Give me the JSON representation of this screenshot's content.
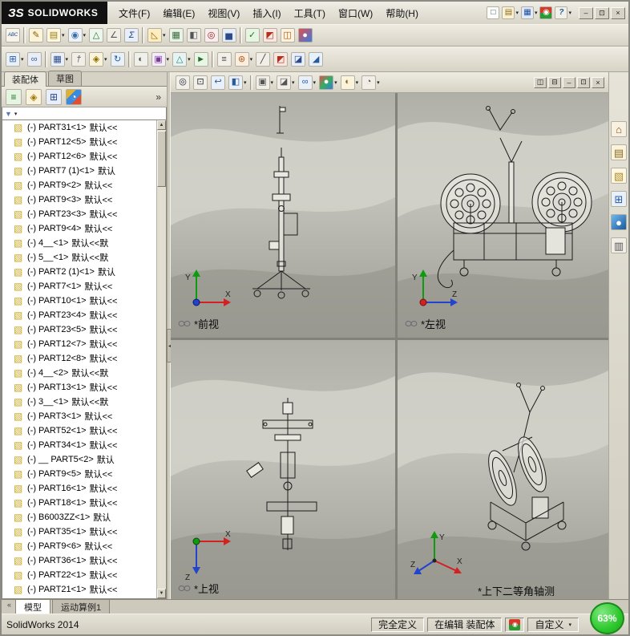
{
  "ui": {
    "dropdown_glyph": "▾",
    "scroll_up_glyph": "▲",
    "scroll_down_glyph": "▼",
    "collapse_glyph": "◂",
    "tab_scroll_glyph": "«"
  },
  "axes": {
    "x": "X",
    "y": "Y",
    "z": "Z"
  },
  "titlebar": {
    "logo": {
      "prefix": "ЗS",
      "text": "SOLIDWORKS"
    },
    "menus": [
      {
        "label": "文件(F)"
      },
      {
        "label": "编辑(E)"
      },
      {
        "label": "视图(V)"
      },
      {
        "label": "插入(I)"
      },
      {
        "label": "工具(T)"
      },
      {
        "label": "窗口(W)"
      },
      {
        "label": "帮助(H)"
      }
    ],
    "quick_icons": [
      {
        "name": "new-document-icon",
        "glyph": "□",
        "css": "color:#33506e;background:#fdfdfa"
      },
      {
        "name": "open-folder-icon",
        "glyph": "▤",
        "css": "color:#8a6a10;background:#fbf2d6",
        "dd": true
      },
      {
        "name": "save-icon",
        "glyph": "▦",
        "css": "color:#1c4f9c;background:#dfe9fa",
        "dd": true
      },
      {
        "name": "rebuild-traffic-icon",
        "glyph": "◉",
        "css": "color:#fff;background:linear-gradient(180deg,#d43a2a 50%,#2a9a32 50%)"
      },
      {
        "name": "help-icon",
        "glyph": "?",
        "css": "color:#1a5a9a;background:#f2f0e8;font-weight:bold",
        "dd": true
      }
    ],
    "window_buttons": [
      {
        "name": "minimize-button",
        "glyph": "–"
      },
      {
        "name": "restore-button",
        "glyph": "⊡"
      },
      {
        "name": "close-button",
        "glyph": "×"
      }
    ]
  },
  "toolbar1": {
    "icons": [
      {
        "name": "spellcheck-icon",
        "glyph": "ABC",
        "css": "color:#14427e;background:#f6f4ec;font-size:6px"
      },
      {
        "name": "toolbar-separator",
        "glyph": "",
        "inter": "false",
        "css": "width:3px;height:20px;background:transparent;border:none;border-left:1px solid #a09c90;border-right:1px solid #faf8f0;border-radius:0"
      },
      {
        "name": "format-painter-icon",
        "glyph": "✎",
        "css": "color:#8a5a00;background:#fcf4d8"
      },
      {
        "name": "note-icon",
        "glyph": "▤",
        "css": "color:#9a7a10;background:#fdf8e0",
        "dd": true
      },
      {
        "name": "balloon-icon",
        "glyph": "◉",
        "css": "color:#3a6ea5;background:#eef2fa",
        "dd": true
      },
      {
        "name": "surface-finish-icon",
        "glyph": "△",
        "css": "color:#2a6a2a;background:#ecf6ec"
      },
      {
        "name": "weld-symbol-icon",
        "glyph": "∠",
        "css": "color:#555;background:#f0eee4"
      },
      {
        "name": "equations-icon",
        "glyph": "Σ",
        "css": "color:#16407c;background:#e8eefa"
      },
      {
        "name": "toolbar-separator",
        "glyph": "",
        "inter": "false",
        "css": "width:3px;height:20px;background:transparent;border:none;border-left:1px solid #a09c90;border-right:1px solid #faf8f0;border-radius:0"
      },
      {
        "name": "measure-icon",
        "glyph": "◺",
        "css": "color:#a06a00;background:#fdeec2",
        "dd": true
      },
      {
        "name": "mass-properties-icon",
        "glyph": "▦",
        "css": "color:#3a6a3a;background:#e8f2e6"
      },
      {
        "name": "section-properties-icon",
        "glyph": "◧",
        "css": "color:#555;background:#eceae2"
      },
      {
        "name": "sensor-icon",
        "glyph": "◎",
        "css": "color:#8a2020;background:#f8ecec"
      },
      {
        "name": "performance-evaluation-icon",
        "glyph": "▅",
        "css": "color:#2a4a8a;background:#e6ecf8"
      },
      {
        "name": "toolbar-separator",
        "glyph": "",
        "inter": "false",
        "css": "width:3px;height:20px;background:transparent;border:none;border-left:1px solid #a09c90;border-right:1px solid #faf8f0;border-radius:0"
      },
      {
        "name": "check-entity-icon",
        "glyph": "✓",
        "css": "color:#1a7a1a;background:#e6f6e2"
      },
      {
        "name": "interference-detection-icon",
        "glyph": "◩",
        "css": "color:#b03020;background:#f8e8e0"
      },
      {
        "name": "hole-alignment-icon",
        "glyph": "◫",
        "css": "color:#b05a00;background:#fdf2e0"
      },
      {
        "name": "appearance-ball-icon",
        "glyph": "●",
        "css": "color:#fff;background:linear-gradient(135deg,#e05050,#3a7ae0)"
      }
    ]
  },
  "toolbar2": {
    "icons": [
      {
        "name": "insert-component-icon",
        "glyph": "⊞",
        "css": "color:#2a5a9a;background:#e8f0fa",
        "dd": true
      },
      {
        "name": "mate-icon",
        "glyph": "∞",
        "css": "color:#3a5a8a;background:#e8eef8"
      },
      {
        "name": "toolbar-separator",
        "glyph": "",
        "inter": "false",
        "css": "width:3px;height:20px;background:transparent;border:none;border-left:1px solid #a09c90;border-right:1px solid #faf8f0;border-radius:0"
      },
      {
        "name": "linear-component-pattern-icon",
        "glyph": "▦",
        "css": "color:#2a4a8a;background:#eaf0fa",
        "dd": true
      },
      {
        "name": "smart-fasteners-icon",
        "glyph": "†",
        "css": "color:#555;background:#f0eee6"
      },
      {
        "name": "move-component-icon",
        "glyph": "◈",
        "css": "color:#8a6a00;background:#fbf4d8",
        "dd": true
      },
      {
        "name": "rotate-component-icon",
        "glyph": "↻",
        "css": "color:#2a5a9a;background:#e8f0fa"
      },
      {
        "name": "toolbar-separator",
        "glyph": "",
        "inter": "false",
        "css": "width:3px;height:20px;background:transparent;border:none;border-left:1px solid #a09c90;border-right:1px solid #faf8f0;border-radius:0"
      },
      {
        "name": "show-hidden-components-icon",
        "glyph": "◐",
        "css": "color:#555;background:#f0f0ea"
      },
      {
        "name": "assembly-features-icon",
        "glyph": "▣",
        "css": "color:#7a3a9a;background:#f4ecf8",
        "dd": true
      },
      {
        "name": "reference-geometry-icon",
        "glyph": "△",
        "css": "color:#2a7a7a;background:#e6f4f4",
        "dd": true
      },
      {
        "name": "new-motion-study-icon",
        "glyph": "►",
        "css": "color:#2a6a2a;background:#e8f6e6"
      },
      {
        "name": "toolbar-separator",
        "glyph": "",
        "inter": "false",
        "css": "width:3px;height:20px;background:transparent;border:none;border-left:1px solid #a09c90;border-right:1px solid #faf8f0;border-radius:0"
      },
      {
        "name": "bill-of-materials-icon",
        "glyph": "≡",
        "css": "color:#444;background:#f2f0e8"
      },
      {
        "name": "exploded-view-icon",
        "glyph": "⊛",
        "css": "color:#b05a20;background:#fbeede",
        "dd": true
      },
      {
        "name": "explode-line-sketch-icon",
        "glyph": "╱",
        "css": "color:#444;background:#f0eee6"
      },
      {
        "name": "interference-volume-icon",
        "glyph": "◩",
        "css": "color:#b03020;background:#f8e6e0"
      },
      {
        "name": "isolate-icon",
        "glyph": "◪",
        "css": "color:#2a4a8a;background:#eaeefa"
      },
      {
        "name": "instant3d-icon",
        "glyph": "◢",
        "css": "color:#2a5a9a;background:#e8f0fa"
      }
    ]
  },
  "viewport": {
    "toolbar_icons": [
      {
        "name": "zoom-fit-icon",
        "glyph": "◎",
        "css": "color:#223;background:#f0f0e8"
      },
      {
        "name": "zoom-area-icon",
        "glyph": "⊡",
        "css": "color:#223;background:#f0f0e8"
      },
      {
        "name": "previous-view-icon",
        "glyph": "↩",
        "css": "color:#2a5a9a;background:#eaf0fa"
      },
      {
        "name": "section-view-icon",
        "glyph": "◧",
        "css": "color:#2a5a9a;background:#eaf0fa",
        "dd": true
      },
      {
        "name": "toolbar-separator",
        "glyph": "",
        "inter": "false",
        "css": "width:3px;height:18px;background:transparent;border:none;border-left:1px solid #a09c90;border-right:1px solid #faf8f0;border-radius:0"
      },
      {
        "name": "view-orientation-icon",
        "glyph": "▣",
        "css": "color:#555;background:#f0eee6",
        "dd": true
      },
      {
        "name": "display-style-icon",
        "glyph": "◪",
        "css": "color:#555;background:#f0eee6",
        "dd": true
      },
      {
        "name": "hide-show-items-icon",
        "glyph": "∞",
        "css": "color:#2a5a9a;background:#eaf0fa",
        "dd": true
      },
      {
        "name": "edit-appearance-icon",
        "glyph": "●",
        "css": "color:#fff;background:linear-gradient(135deg,#e05050,#30b060,#3a7ae0)",
        "dd": true
      },
      {
        "name": "apply-scene-icon",
        "glyph": "◐",
        "css": "color:#8a6a20;background:#fbf4dc",
        "dd": true
      },
      {
        "name": "view-settings-icon",
        "glyph": "◔",
        "css": "color:#555;background:#f0eee6",
        "dd": true
      }
    ],
    "window_buttons": [
      {
        "name": "pane-left-button",
        "glyph": "◫"
      },
      {
        "name": "pane-right-button",
        "glyph": "⊟"
      },
      {
        "name": "child-minimize-button",
        "glyph": "–"
      },
      {
        "name": "child-restore-button",
        "glyph": "⊡"
      },
      {
        "name": "child-close-button",
        "glyph": "×"
      }
    ],
    "views": [
      {
        "label": "*前视"
      },
      {
        "label": "*左视"
      },
      {
        "label": "*上视"
      },
      {
        "label": "*上下二等角轴测"
      }
    ]
  },
  "left_panel": {
    "tabs": [
      {
        "label": "装配体"
      },
      {
        "label": "草图"
      }
    ],
    "expand_label": "»",
    "part_icon_glyph": "▧",
    "manager_icons": [
      {
        "name": "featuremanager-tree-icon",
        "glyph": "≡",
        "css": "color:#1f6f1f;background:#e6f4e2"
      },
      {
        "name": "propertymanager-icon",
        "glyph": "◈",
        "css": "color:#a07a10;background:#fcf4da"
      },
      {
        "name": "configurationmanager-icon",
        "glyph": "⊞",
        "css": "color:#2a4a8a;background:#e8eefa"
      },
      {
        "name": "displaymanager-icon",
        "glyph": "◔",
        "css": "color:#fff;background:linear-gradient(135deg,#e0b030 33%,#3a8ae0 33% 66%,#e05030 66%)"
      }
    ],
    "tree_items": [
      {
        "name": "(-) PART31<1>",
        "config": "默认<<"
      },
      {
        "name": "(-) PART12<5>",
        "config": "默认<<"
      },
      {
        "name": "(-) PART12<6>",
        "config": "默认<<"
      },
      {
        "name": "(-) PART7 (1)<1>",
        "config": "默认"
      },
      {
        "name": "(-) PART9<2>",
        "config": "默认<<"
      },
      {
        "name": "(-) PART9<3>",
        "config": "默认<<"
      },
      {
        "name": "(-) PART23<3>",
        "config": "默认<<"
      },
      {
        "name": "(-) PART9<4>",
        "config": "默认<<"
      },
      {
        "name": "(-) 4__<1>",
        "config": "默认<<默"
      },
      {
        "name": "(-) 5__<1>",
        "config": "默认<<默"
      },
      {
        "name": "(-) PART2 (1)<1>",
        "config": "默认"
      },
      {
        "name": "(-) PART7<1>",
        "config": "默认<<"
      },
      {
        "name": "(-) PART10<1>",
        "config": "默认<<"
      },
      {
        "name": "(-) PART23<4>",
        "config": "默认<<"
      },
      {
        "name": "(-) PART23<5>",
        "config": "默认<<"
      },
      {
        "name": "(-) PART12<7>",
        "config": "默认<<"
      },
      {
        "name": "(-) PART12<8>",
        "config": "默认<<"
      },
      {
        "name": "(-) 4__<2>",
        "config": "默认<<默"
      },
      {
        "name": "(-) PART13<1>",
        "config": "默认<<"
      },
      {
        "name": "(-) 3__<1>",
        "config": "默认<<默"
      },
      {
        "name": "(-) PART3<1>",
        "config": "默认<<"
      },
      {
        "name": "(-) PART52<1>",
        "config": "默认<<"
      },
      {
        "name": "(-) PART34<1>",
        "config": "默认<<"
      },
      {
        "name": "(-) __ PART5<2>",
        "config": "默认"
      },
      {
        "name": "(-) PART9<5>",
        "config": "默认<<"
      },
      {
        "name": "(-) PART16<1>",
        "config": "默认<<"
      },
      {
        "name": "(-) PART18<1>",
        "config": "默认<<"
      },
      {
        "name": "(-) B6003ZZ<1>",
        "config": "默认"
      },
      {
        "name": "(-) PART35<1>",
        "config": "默认<<"
      },
      {
        "name": "(-) PART9<6>",
        "config": "默认<<"
      },
      {
        "name": "(-) PART36<1>",
        "config": "默认<<"
      },
      {
        "name": "(-) PART22<1>",
        "config": "默认<<"
      },
      {
        "name": "(-) PART21<1>",
        "config": "默认<<"
      }
    ]
  },
  "right_toolbar": {
    "icons": [
      {
        "name": "home-icon",
        "glyph": "⌂",
        "css": "color:#8a4a10;background:#f8f0e0"
      },
      {
        "name": "design-library-icon",
        "glyph": "▤",
        "css": "color:#8a6a20;background:#fbf4dc"
      },
      {
        "name": "file-explorer-icon",
        "glyph": "▧",
        "css": "color:#b08a20;background:#fdf6e0"
      },
      {
        "name": "view-palette-icon",
        "glyph": "⊞",
        "css": "color:#2a5a9a;background:#e8f0fa"
      },
      {
        "name": "appearances-icon",
        "glyph": "●",
        "css": "color:#fff;background:linear-gradient(135deg,#70b8f0,#1a5a9a)"
      },
      {
        "name": "custom-properties-icon",
        "glyph": "▥",
        "css": "color:#555;background:#f0eee6"
      }
    ]
  },
  "bottom_tabs": [
    {
      "label": "模型"
    },
    {
      "label": "运动算例1"
    }
  ],
  "statusbar": {
    "app": "SolidWorks 2014",
    "define_state": "完全定义",
    "edit_state": "在编辑 装配体",
    "custom_label": "自定义",
    "zoom": "63%"
  }
}
